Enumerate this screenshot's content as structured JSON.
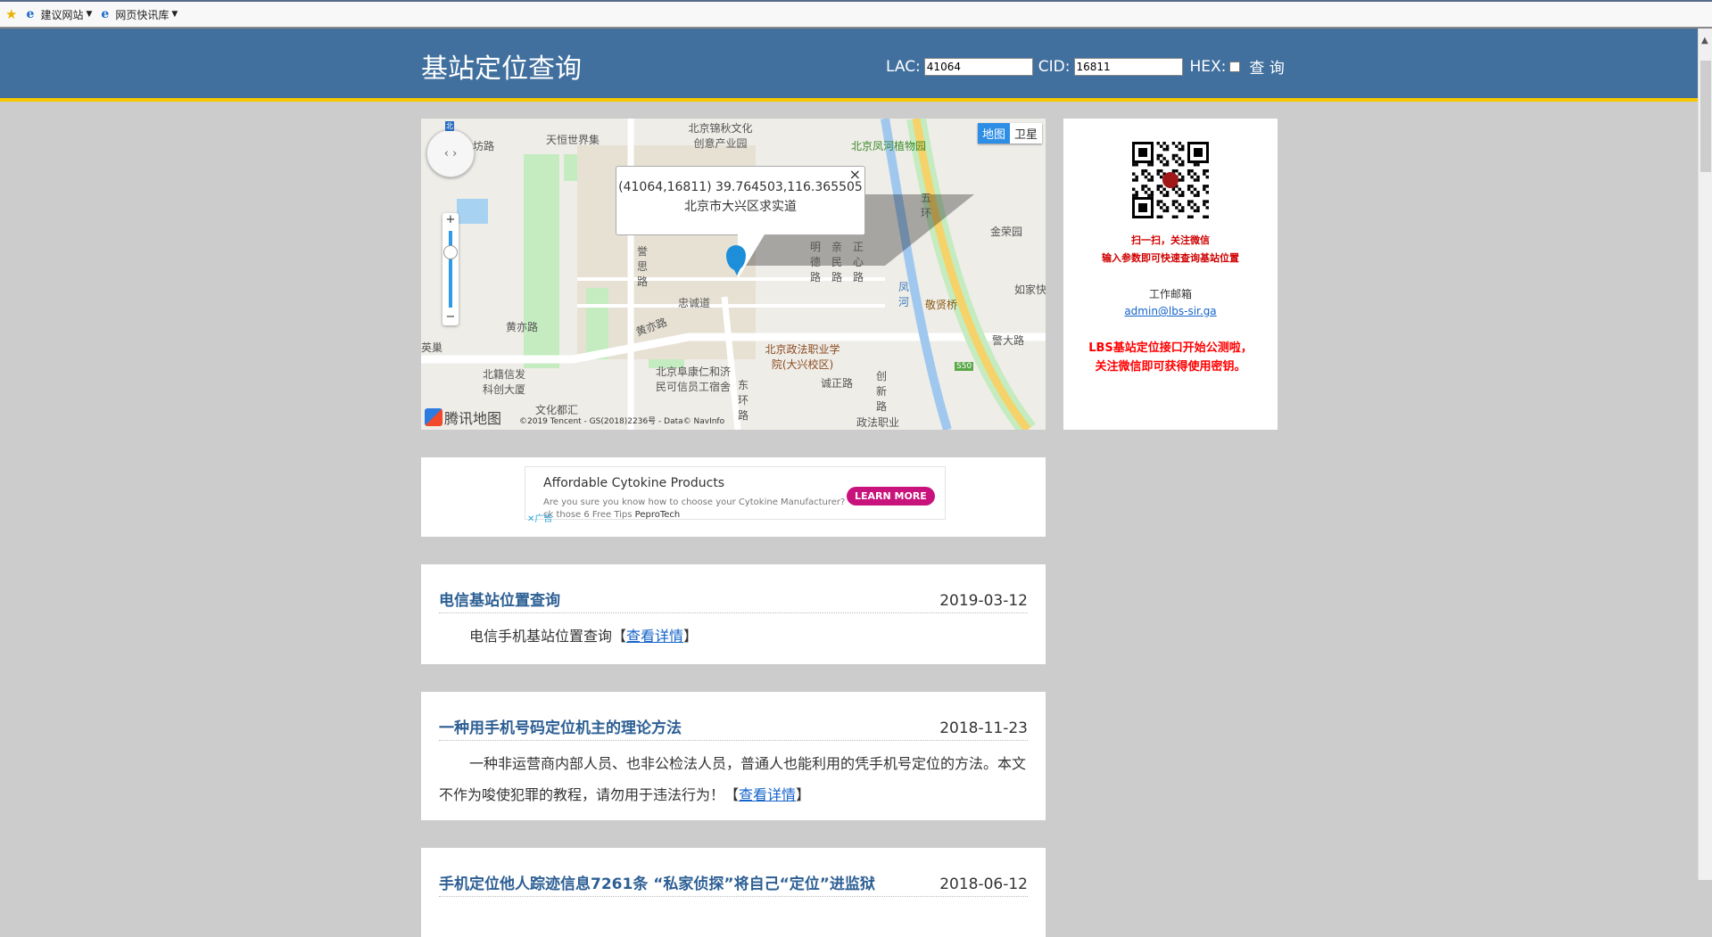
{
  "toolbar": {
    "items": [
      {
        "label": "建议网站",
        "icon": "ie-icon"
      },
      {
        "label": "网页快讯库",
        "icon": "ie-icon"
      }
    ]
  },
  "header": {
    "title": "基站定位查询",
    "lac_label": "LAC:",
    "lac_value": "41064",
    "cid_label": "CID:",
    "cid_value": "16811",
    "hex_label": "HEX:",
    "hex_checked": false,
    "query_label": "查 询"
  },
  "map": {
    "type_buttons": [
      "地图",
      "卫星"
    ],
    "active_type": "地图",
    "compass_label": "北",
    "popup": {
      "line1": "(41064,16811) 39.764503,116.365505",
      "line2": "北京市大兴区求实道"
    },
    "logo": "腾讯地图",
    "copyright": "©2019 Tencent - GS(2018)2236号 - Data© NavInfo",
    "labels": [
      "天恒世界集",
      "北京锦秋文化创意产业园",
      "北京凤河植物园",
      "金荣园",
      "如家快",
      "敬贤桥",
      "警大路",
      "北京政法职业学院(大兴校区)",
      "北京阜康仁和济民可信员工宿舍",
      "北籍信发科创大厦",
      "文化都汇",
      "黄亦路",
      "黄亦路",
      "忠诚道",
      "诚正路",
      "创新路",
      "东环路",
      "政法职业",
      "五环",
      "凤河",
      "明德路",
      "亲民路",
      "正心路",
      "誉思路",
      "坊路",
      "英巢",
      "S50"
    ]
  },
  "sidebar": {
    "scan_line1": "扫一扫，关注微信",
    "scan_line2": "输入参数即可快速查询基站位置",
    "email_label": "工作邮箱",
    "email": "admin@lbs-sir.ga",
    "notice_line1": "LBS基站定位接口开始公测啦，",
    "notice_line2": "关注微信即可获得使用密钥。"
  },
  "ad": {
    "title": "Affordable Cytokine Products",
    "text1": "Are you sure you know how to choose your Cytokine Manufacturer?",
    "text2": "ck those 6 Free Tips",
    "brand": "PeproTech",
    "cta": "LEARN MORE",
    "ad_label": "广告",
    "cta_color": "#c8127c"
  },
  "articles": [
    {
      "title": "电信基站位置查询",
      "date": "2019-03-12",
      "body": "电信手机基站位置查询【",
      "link": "查看详情",
      "tail": "】"
    },
    {
      "title": "一种用手机号码定位机主的理论方法",
      "date": "2018-11-23",
      "body": "一种非运营商内部人员、也非公检法人员，普通人也能利用的凭手机号定位的方法。本文不作为唆使犯罪的教程，请勿用于违法行为！【",
      "link": "查看详情",
      "tail": "】"
    },
    {
      "title": "手机定位他人踪迹信息7261条 “私家侦探”将自己“定位”进监狱",
      "date": "2018-06-12"
    }
  ]
}
